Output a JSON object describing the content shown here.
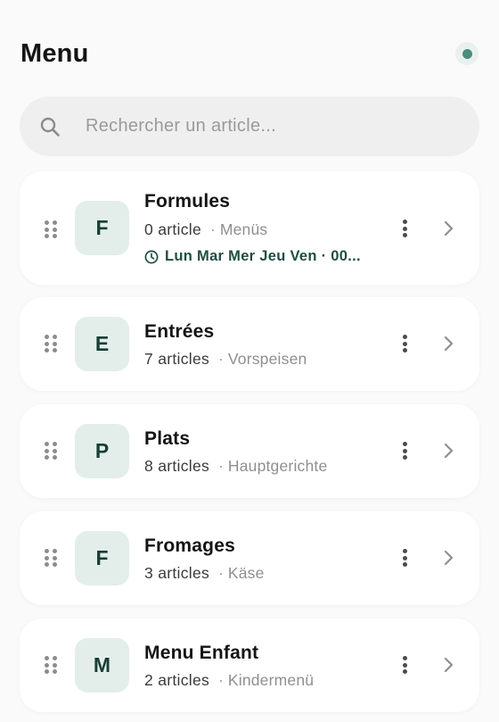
{
  "header": {
    "title": "Menu",
    "status_color": "#4b8d7b"
  },
  "search": {
    "placeholder": "Rechercher un article...",
    "icon": "search-icon"
  },
  "categories": [
    {
      "letter": "F",
      "name": "Formules",
      "count": "0 article",
      "separator": "·",
      "subtitle": "Menüs",
      "schedule": "Lun Mar Mer Jeu Ven · 00..."
    },
    {
      "letter": "E",
      "name": "Entrées",
      "count": "7 articles",
      "separator": "·",
      "subtitle": "Vorspeisen"
    },
    {
      "letter": "P",
      "name": "Plats",
      "count": "8 articles",
      "separator": "·",
      "subtitle": "Hauptgerichte"
    },
    {
      "letter": "F",
      "name": "Fromages",
      "count": "3 articles",
      "separator": "·",
      "subtitle": "Käse"
    },
    {
      "letter": "M",
      "name": "Menu Enfant",
      "count": "2 articles",
      "separator": "·",
      "subtitle": "Kindermenü"
    }
  ],
  "colors": {
    "accent": "#1e4d42",
    "avatar_bg": "#e3eeea",
    "search_bg": "#efefef"
  }
}
